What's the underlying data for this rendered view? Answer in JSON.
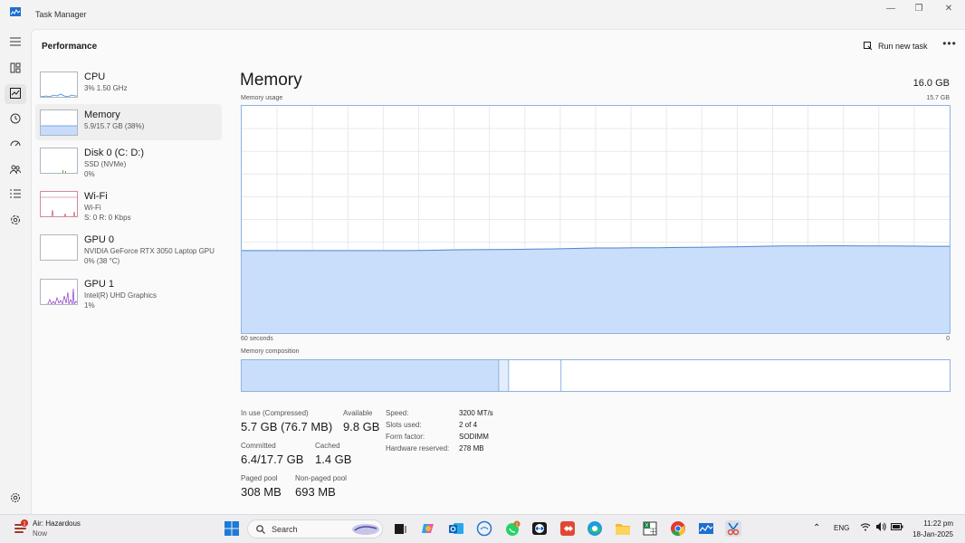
{
  "window": {
    "title": "Task Manager",
    "minimize_icon": "minimize-icon",
    "maximize_icon": "restore-icon",
    "close_icon": "close-icon"
  },
  "nav": {
    "items": [
      {
        "icon": "hamburger-menu-icon"
      },
      {
        "icon": "processes-icon"
      },
      {
        "icon": "performance-icon",
        "active": true
      },
      {
        "icon": "app-history-icon"
      },
      {
        "icon": "startup-apps-icon"
      },
      {
        "icon": "users-icon"
      },
      {
        "icon": "details-icon"
      },
      {
        "icon": "services-icon"
      }
    ],
    "settings_icon": "settings-icon"
  },
  "header": {
    "page_title": "Performance",
    "run_new_task": "Run new task",
    "more_icon": "more-options-icon"
  },
  "devices": [
    {
      "name": "CPU",
      "line1": "3%  1.50 GHz",
      "line2": ""
    },
    {
      "name": "Memory",
      "line1": "5.9/15.7 GB (38%)",
      "line2": "",
      "selected": true
    },
    {
      "name": "Disk 0 (C: D:)",
      "line1": "SSD (NVMe)",
      "line2": "0%"
    },
    {
      "name": "Wi-Fi",
      "line1": "Wi-Fi",
      "line2": "S: 0  R: 0 Kbps"
    },
    {
      "name": "GPU 0",
      "line1": "NVIDIA GeForce RTX 3050 Laptop GPU",
      "line2": "0%  (38 °C)"
    },
    {
      "name": "GPU 1",
      "line1": "Intel(R) UHD Graphics",
      "line2": "1%"
    }
  ],
  "memory": {
    "title": "Memory",
    "total": "16.0 GB",
    "usage_label": "Memory usage",
    "usage_max": "15.7 GB",
    "time_label": "60 seconds",
    "zero_label": "0",
    "composition_label": "Memory composition",
    "stats": {
      "in_use_label": "In use (Compressed)",
      "in_use_value": "5.7 GB (76.7 MB)",
      "available_label": "Available",
      "available_value": "9.8 GB",
      "committed_label": "Committed",
      "committed_value": "6.4/17.7 GB",
      "cached_label": "Cached",
      "cached_value": "1.4 GB",
      "paged_label": "Paged pool",
      "paged_value": "308 MB",
      "nonpaged_label": "Non-paged pool",
      "nonpaged_value": "693 MB"
    },
    "details": [
      {
        "label": "Speed:",
        "value": "3200 MT/s"
      },
      {
        "label": "Slots used:",
        "value": "2 of 4"
      },
      {
        "label": "Form factor:",
        "value": "SODIMM"
      },
      {
        "label": "Hardware reserved:",
        "value": "278 MB"
      }
    ],
    "composition_fractions": {
      "in_use": 0.363,
      "modified": 0.014,
      "standby": 0.074
    }
  },
  "chart_data": {
    "type": "area",
    "title": "Memory usage",
    "x_range_seconds": [
      60,
      0
    ],
    "ylim": [
      0,
      15.7
    ],
    "y_unit": "GB",
    "values": [
      5.7,
      5.7,
      5.7,
      5.7,
      5.7,
      5.7,
      5.7,
      5.7,
      5.7,
      5.72,
      5.75,
      5.76,
      5.77,
      5.78,
      5.8,
      5.82,
      5.85,
      5.88,
      5.88,
      5.9,
      5.9,
      5.92,
      5.93,
      5.95,
      5.97,
      6.0,
      6.02,
      6.02,
      6.03,
      6.03,
      6.02,
      6.02,
      6.01,
      6.0,
      6.0
    ],
    "grid": true
  },
  "taskbar": {
    "weather_title": "Air: Hazardous",
    "weather_sub": "Now",
    "weather_badge": "1",
    "search_label": "Search",
    "start_icon": "windows-start-icon",
    "search_icon": "search-icon",
    "apps": [
      "task-view-icon",
      "copilot-icon",
      "outlook-icon",
      "app-circle-icon",
      "whatsapp-icon",
      "teamviewer-icon",
      "anydesk-icon",
      "edge-icon",
      "file-explorer-icon",
      "excel-icon",
      "chrome-icon",
      "task-manager-icon",
      "snipping-tool-icon"
    ],
    "whatsapp_badge": "1",
    "language": "ENG",
    "time": "11:22 pm",
    "date": "18-Jan-2025"
  }
}
